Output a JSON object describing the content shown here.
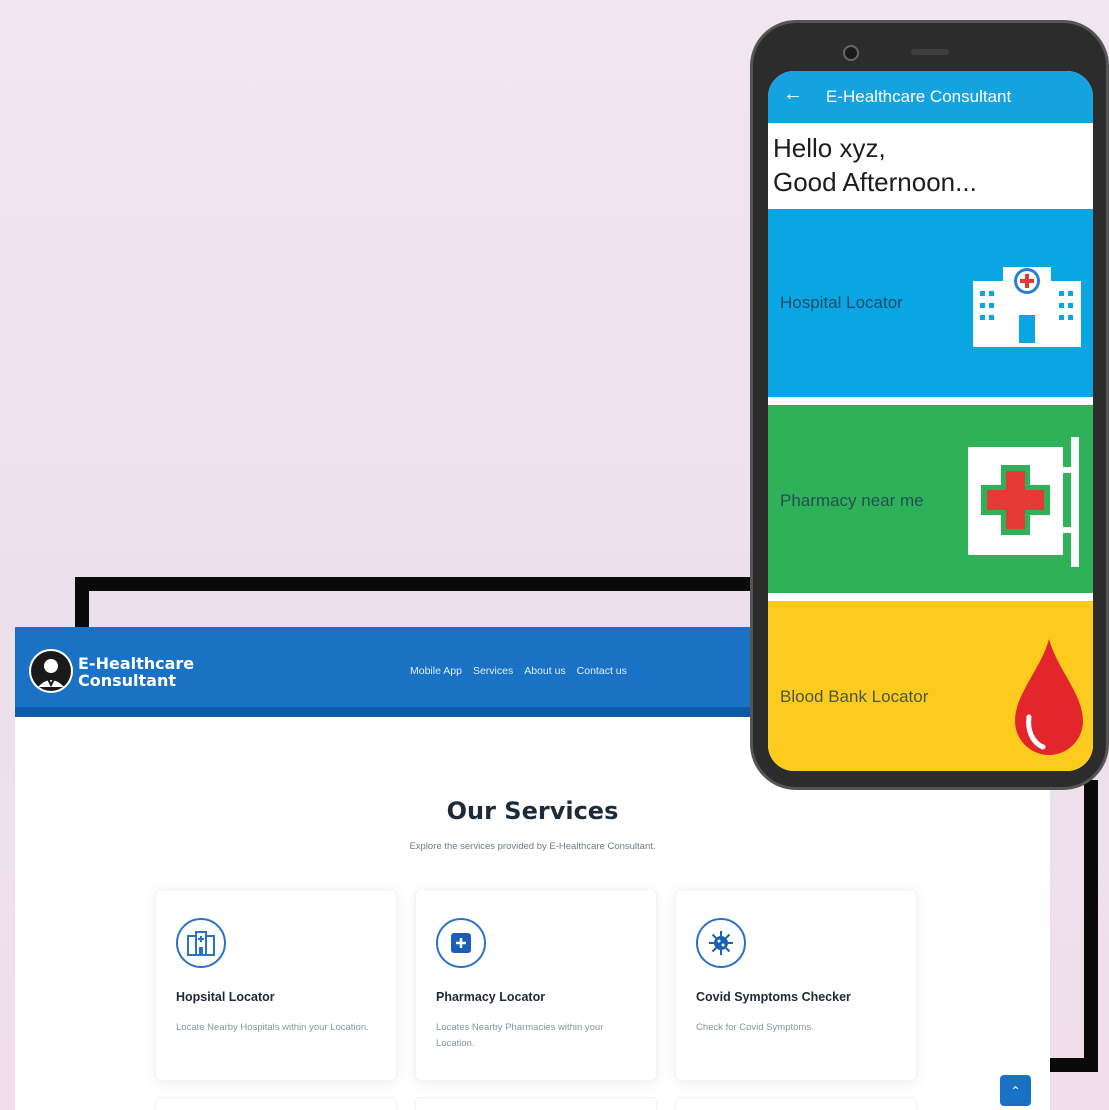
{
  "website": {
    "logo": {
      "line1": "E-Healthcare",
      "line2": "Consultant"
    },
    "nav": [
      "Mobile App",
      "Services",
      "About us",
      "Contact us"
    ],
    "section_title": "Our Services",
    "section_subtitle": "Explore the services provided by E-Healthcare Consultant.",
    "cards": [
      {
        "icon": "hospital-building-icon",
        "title": "Hopsital Locator",
        "desc": "Locate Nearby Hospitals within your Location."
      },
      {
        "icon": "pharmacy-plus-icon",
        "title": "Pharmacy Locator",
        "desc": "Locates Nearby Pharmacies within your Location."
      },
      {
        "icon": "virus-icon",
        "title": "Covid Symptoms Checker",
        "desc": "Check for Covid Symptoms."
      }
    ],
    "scroll_top_icon": "chevron-up-icon"
  },
  "phone_app": {
    "title": "E-Healthcare Consultant",
    "greeting_line1": "Hello xyz,",
    "greeting_line2": "Good Afternoon...",
    "tiles": [
      {
        "label": "Hospital Locator",
        "color": "#0aa6e3",
        "icon": "hospital-icon"
      },
      {
        "label": "Pharmacy near me",
        "color": "#2fb15a",
        "icon": "pharmacy-sign-icon"
      },
      {
        "label": "Blood Bank Locator",
        "color": "#fccb1e",
        "icon": "blood-drop-icon"
      }
    ]
  },
  "colors": {
    "brand_blue": "#1a72c4",
    "app_bar": "#15a3e0",
    "hospital_tile": "#0aa6e3",
    "pharmacy_tile": "#2fb15a",
    "blood_tile": "#fccb1e"
  }
}
